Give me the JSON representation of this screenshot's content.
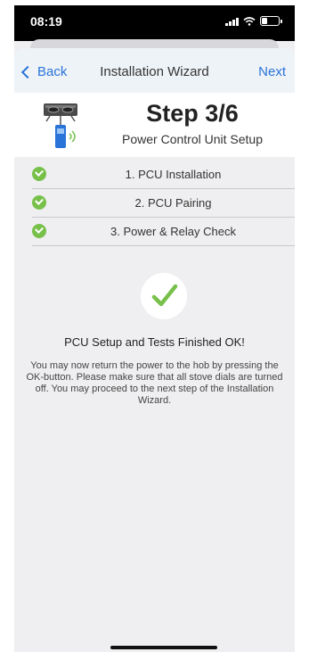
{
  "status_bar": {
    "time": "08:19"
  },
  "nav": {
    "back_label": "Back",
    "title": "Installation Wizard",
    "next_label": "Next"
  },
  "header": {
    "step": "Step 3/6",
    "subtitle": "Power Control Unit Setup"
  },
  "steps": [
    {
      "label": "1. PCU Installation",
      "status": "done"
    },
    {
      "label": "2. PCU Pairing",
      "status": "done"
    },
    {
      "label": "3. Power & Relay Check",
      "status": "done"
    }
  ],
  "result": {
    "title": "PCU Setup and Tests Finished OK!",
    "description": "You may now return the power to the hob by pressing the OK-button. Please make sure that all stove dials are turned off. You may proceed to the next step of the Installation Wizard."
  },
  "colors": {
    "accent": "#2a73d9",
    "success": "#77c14b",
    "background": "#efeff1"
  }
}
